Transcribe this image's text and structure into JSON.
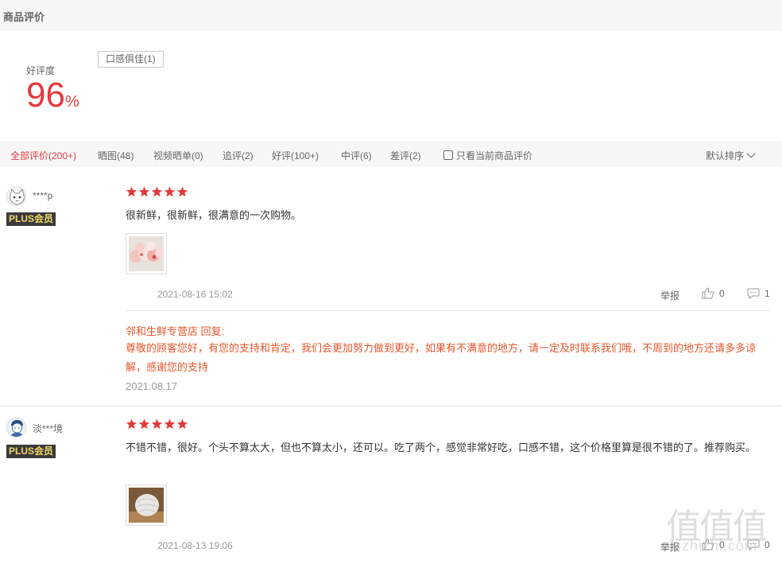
{
  "header": {
    "title": "商品评价"
  },
  "summary": {
    "good_rate_label": "好评度",
    "good_rate_value": "96",
    "good_rate_unit": "%",
    "tags": [
      "口感俱佳(1)"
    ]
  },
  "filters": {
    "items": [
      {
        "label": "全部评价(200+)",
        "active": true
      },
      {
        "label": "晒图(48)"
      },
      {
        "label": "视频晒单(0)"
      },
      {
        "label": "追评(2)"
      },
      {
        "label": "好评(100+)"
      },
      {
        "label": "中评(6)"
      },
      {
        "label": "差评(2)"
      }
    ],
    "only_current_label": "只看当前商品评价",
    "sort_label": "默认排序"
  },
  "reviews": [
    {
      "username": "****p",
      "badge": "PLUS会员",
      "rating": 5,
      "comment": "很新鲜，很新鲜，很满意的一次购物。",
      "date": "2021-08-16 15:02",
      "report_label": "举报",
      "likes": "0",
      "comments": "1",
      "reply": {
        "author": "邻和生鲜专营店 回复:",
        "text": "尊敬的顾客您好，有您的支持和肯定，我们会更加努力做到更好，如果有不满意的地方，请一定及时联系我们哦，不周到的地方还请多多谅解，感谢您的支持",
        "date": "2021.08.17"
      }
    },
    {
      "username": "淡***境",
      "badge": "PLUS会员",
      "rating": 5,
      "comment": "不错不错，很好。个头不算太大，但也不算太小，还可以。吃了两个，感觉非常好吃，口感不错，这个价格里算是很不错的了。推荐购买。",
      "date": "2021-08-13 19:06",
      "report_label": "举报",
      "likes": "0",
      "comments": "0"
    }
  ],
  "watermark": {
    "chars": "值值值",
    "text": "zhizhizhi.com"
  },
  "colors": {
    "accent": "#e4393c",
    "reply": "#e4572d",
    "plus_bg": "#3a3a3a",
    "plus_fg": "#f0d66b"
  }
}
